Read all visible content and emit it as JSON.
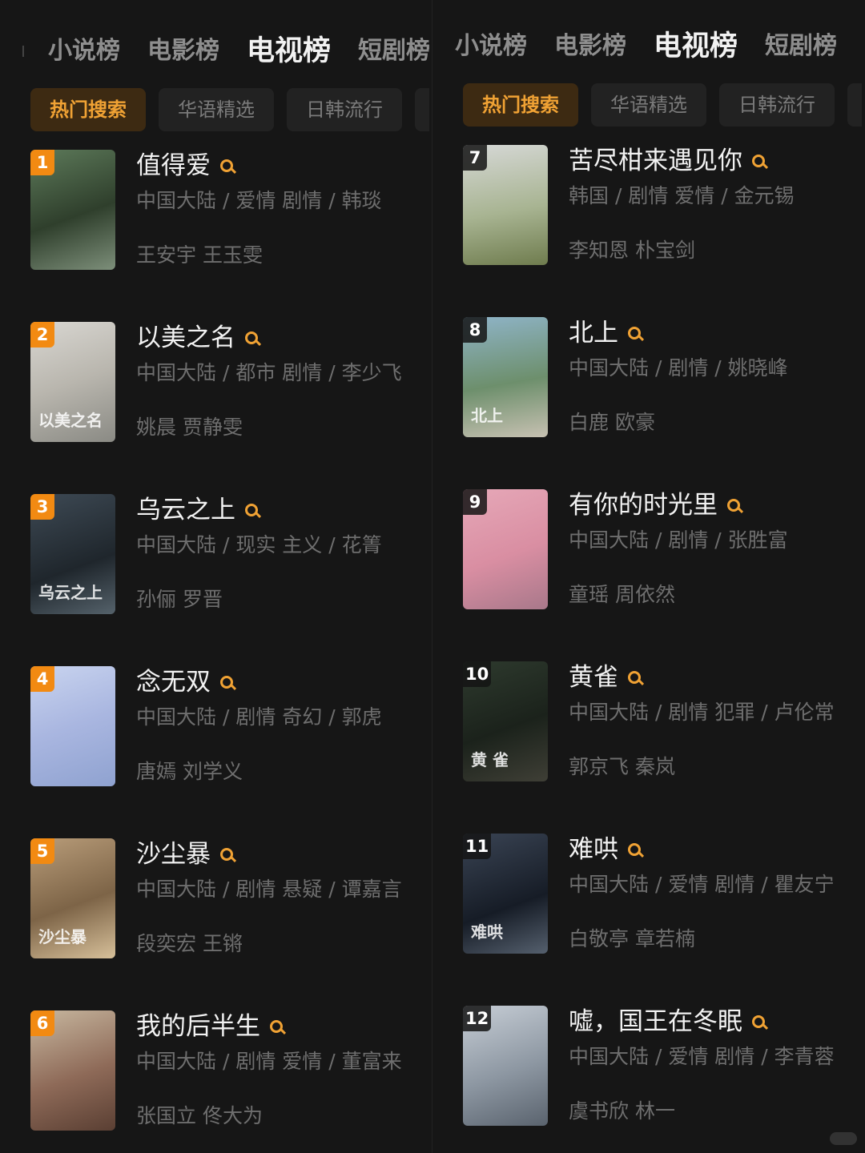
{
  "tabs": [
    "小说榜",
    "电影榜",
    "电视榜",
    "短剧榜"
  ],
  "active_tab": "电视榜",
  "chips": [
    "热门搜索",
    "华语精选",
    "日韩流行"
  ],
  "active_chip": "热门搜索",
  "colors": {
    "accent": "#f0a234",
    "rank_top": "#f28a12",
    "background": "#161616"
  },
  "left_list": [
    {
      "rank": "1",
      "title": "值得爱",
      "meta": "中国大陆 / 爱情 剧情 / 韩琰",
      "cast": "王安宇 王玉雯",
      "poster_text": ""
    },
    {
      "rank": "2",
      "title": "以美之名",
      "meta": "中国大陆 / 都市 剧情 / 李少飞",
      "cast": "姚晨 贾静雯",
      "poster_text": "以美之名"
    },
    {
      "rank": "3",
      "title": "乌云之上",
      "meta": "中国大陆 / 现实 主义 / 花箐",
      "cast": "孙俪 罗晋",
      "poster_text": "乌云之上"
    },
    {
      "rank": "4",
      "title": "念无双",
      "meta": "中国大陆 / 剧情 奇幻 / 郭虎",
      "cast": "唐嫣 刘学义",
      "poster_text": ""
    },
    {
      "rank": "5",
      "title": "沙尘暴",
      "meta": "中国大陆 / 剧情 悬疑 / 谭嘉言",
      "cast": "段奕宏 王锵",
      "poster_text": "沙尘暴"
    },
    {
      "rank": "6",
      "title": "我的后半生",
      "meta": "中国大陆 / 剧情 爱情 / 董富来",
      "cast": "张国立 佟大为",
      "poster_text": ""
    }
  ],
  "right_list": [
    {
      "rank": "7",
      "title": "苦尽柑来遇见你",
      "meta": "韩国 / 剧情 爱情 / 金元锡",
      "cast": "李知恩 朴宝剑",
      "poster_text": ""
    },
    {
      "rank": "8",
      "title": "北上",
      "meta": "中国大陆 / 剧情 / 姚晓峰",
      "cast": "白鹿 欧豪",
      "poster_text": "北上"
    },
    {
      "rank": "9",
      "title": "有你的时光里",
      "meta": "中国大陆 / 剧情 / 张胜富",
      "cast": "童瑶 周依然",
      "poster_text": ""
    },
    {
      "rank": "10",
      "title": "黄雀",
      "meta": "中国大陆 / 剧情 犯罪 / 卢伦常",
      "cast": "郭京飞 秦岚",
      "poster_text": "黄 雀"
    },
    {
      "rank": "11",
      "title": "难哄",
      "meta": "中国大陆 / 爱情 剧情 / 瞿友宁",
      "cast": "白敬亭 章若楠",
      "poster_text": "难哄"
    },
    {
      "rank": "12",
      "title": "嘘，国王在冬眠",
      "meta": "中国大陆 / 爱情 剧情 / 李青蓉",
      "cast": "虞书欣 林一",
      "poster_text": ""
    }
  ]
}
